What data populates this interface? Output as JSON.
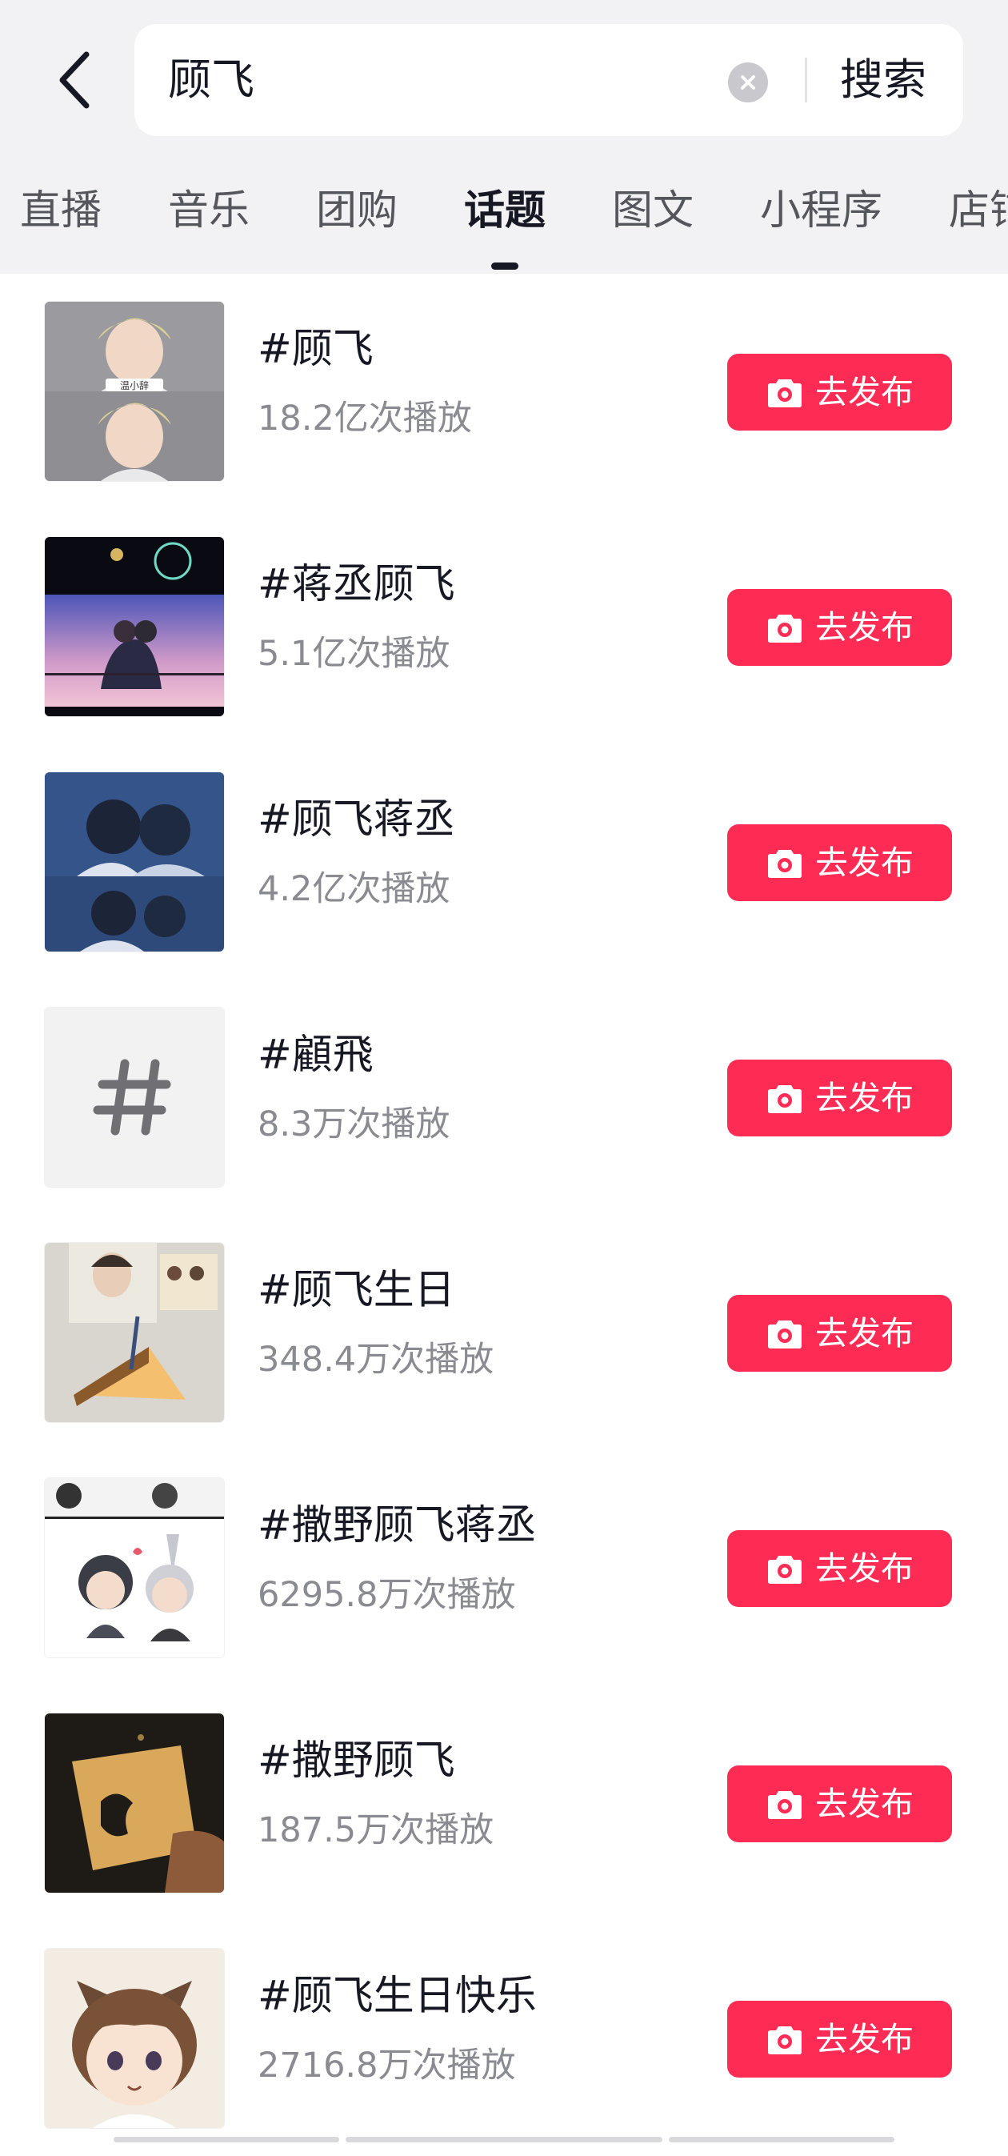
{
  "search": {
    "query": "顾飞",
    "submit_label": "搜索"
  },
  "tabs": [
    {
      "label": "直播"
    },
    {
      "label": "音乐"
    },
    {
      "label": "团购"
    },
    {
      "label": "话题",
      "active": true
    },
    {
      "label": "图文"
    },
    {
      "label": "小程序"
    },
    {
      "label": "店铺"
    }
  ],
  "topics": [
    {
      "title": "#顾飞",
      "plays": "18.2亿次播放",
      "publish_label": "去发布",
      "thumb": "avatar-blond-portrait"
    },
    {
      "title": "#蒋丞顾飞",
      "plays": "5.1亿次播放",
      "publish_label": "去发布",
      "thumb": "fireworks-couple"
    },
    {
      "title": "#顾飞蒋丞",
      "plays": "4.2亿次播放",
      "publish_label": "去发布",
      "thumb": "blue-illustration"
    },
    {
      "title": "#顧飛",
      "plays": "8.3万次播放",
      "publish_label": "去发布",
      "thumb": "hashtag-placeholder"
    },
    {
      "title": "#顾飞生日",
      "plays": "348.4万次播放",
      "publish_label": "去发布",
      "thumb": "birthday-cake"
    },
    {
      "title": "#撒野顾飞蒋丞",
      "plays": "6295.8万次播放",
      "publish_label": "去发布",
      "thumb": "chibi-comic"
    },
    {
      "title": "#撒野顾飞",
      "plays": "187.5万次播放",
      "publish_label": "去发布",
      "thumb": "dark-card"
    },
    {
      "title": "#顾飞生日快乐",
      "plays": "2716.8万次播放",
      "publish_label": "去发布",
      "thumb": "cat-ear-boy"
    }
  ],
  "colors": {
    "accent": "#fe2c55",
    "header_bg": "#f2f2f4",
    "text_primary": "#161823",
    "text_secondary": "#8a8b91"
  },
  "icons": {
    "back": "chevron-left-icon",
    "clear": "clear-circle-icon",
    "publish": "camera-icon"
  }
}
